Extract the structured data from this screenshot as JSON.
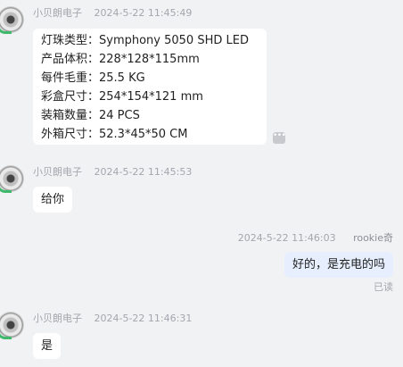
{
  "messages": [
    {
      "sender": "小贝朗电子",
      "time": "2024-5-22 11:45:49",
      "lines": [
        "灯珠类型：Symphony 5050 SHD LED",
        "产品体积：228*128*115mm",
        "每件毛重：25.5 KG",
        "彩盒尺寸：254*154*121 mm",
        "装箱数量：24 PCS",
        "外箱尺寸：52.3*45*50 CM"
      ]
    },
    {
      "sender": "小贝朗电子",
      "time": "2024-5-22 11:45:53",
      "text": "给你"
    },
    {
      "sender": "rookie奇",
      "time": "2024-5-22 11:46:03",
      "text": "好的，是充电的吗",
      "status": "已读"
    },
    {
      "sender": "小贝朗电子",
      "time": "2024-5-22 11:46:31",
      "text": "是"
    }
  ],
  "icons": {
    "more": "more-dots-icon",
    "avatar": "avatar-disc-icon"
  }
}
